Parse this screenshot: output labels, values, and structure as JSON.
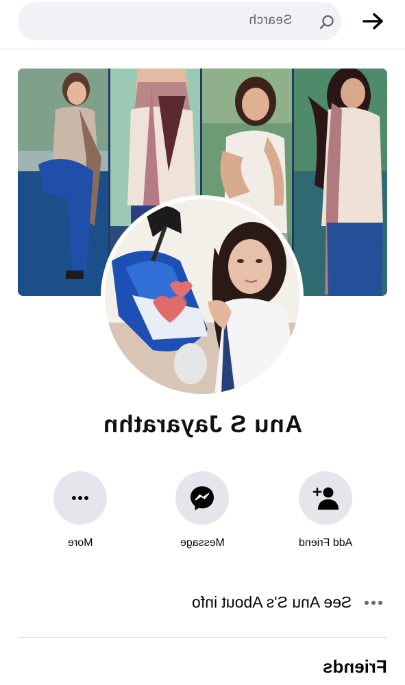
{
  "topbar": {
    "search_placeholder": "Search",
    "search_icon": "search-icon",
    "back_icon": "arrow-right-icon"
  },
  "profile": {
    "name": "Anu S Jayarathn",
    "cover_photo": "photo-collage",
    "avatar": "profile-photo"
  },
  "actions": [
    {
      "label": "Add Friend",
      "icon": "add-friend-icon"
    },
    {
      "label": "Message",
      "icon": "messenger-icon"
    },
    {
      "label": "More",
      "icon": "more-icon"
    }
  ],
  "about": {
    "label": "See Anu S's About info",
    "icon": "more-dots-icon"
  },
  "sections": {
    "friends_title": "Friends"
  },
  "colors": {
    "button_bg": "#e4e6eb",
    "search_bg": "#f0f2f5",
    "text": "#050505",
    "secondary_text": "#65676b"
  }
}
